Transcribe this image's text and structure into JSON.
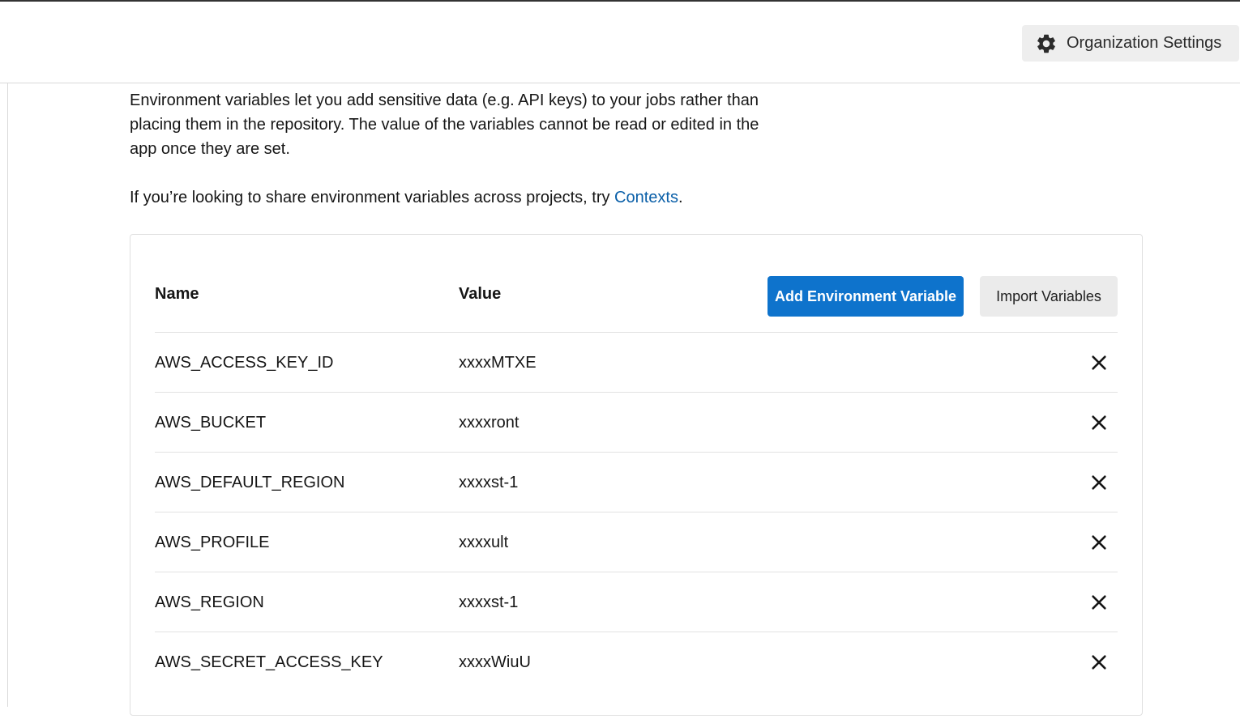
{
  "header": {
    "org_settings_label": "Organization Settings"
  },
  "intro": {
    "paragraph1": "Environment variables let you add sensitive data (e.g. API keys) to your jobs rather than placing them in the repository. The value of the variables cannot be read or edited in the app once they are set.",
    "share_prefix": "If you’re looking to share environment variables across projects, try ",
    "contexts_link": "Contexts",
    "share_suffix": "."
  },
  "table": {
    "col_name": "Name",
    "col_value": "Value",
    "add_button": "Add Environment Variable",
    "import_button": "Import Variables",
    "rows": [
      {
        "name": "AWS_ACCESS_KEY_ID",
        "value": "xxxxMTXE"
      },
      {
        "name": "AWS_BUCKET",
        "value": "xxxxront"
      },
      {
        "name": "AWS_DEFAULT_REGION",
        "value": "xxxxst-1"
      },
      {
        "name": "AWS_PROFILE",
        "value": "xxxxult"
      },
      {
        "name": "AWS_REGION",
        "value": "xxxxst-1"
      },
      {
        "name": "AWS_SECRET_ACCESS_KEY",
        "value": "xxxxWiuU"
      }
    ]
  },
  "icons": {
    "settings": "gear-icon",
    "delete": "close-icon"
  },
  "colors": {
    "primary": "#0e73cc",
    "link": "#0a5fa8",
    "secondary_bg": "#ebebeb"
  }
}
